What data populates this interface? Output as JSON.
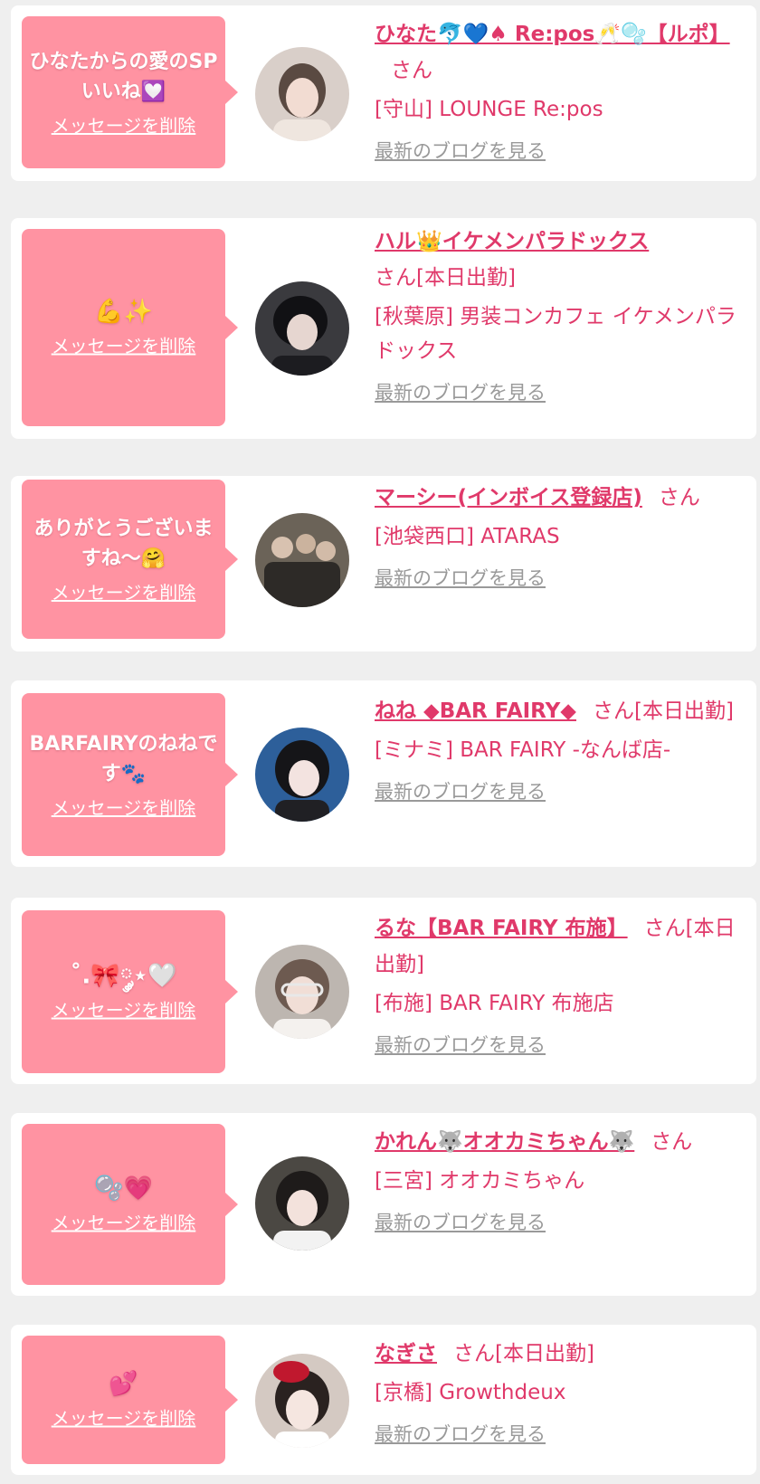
{
  "colors": {
    "background": "#efefef",
    "card": "#ffffff",
    "bubble": "#ff93a2",
    "accent": "#e0396a",
    "muted_link": "#999999"
  },
  "common": {
    "delete_label": "メッセージを削除",
    "blog_label": "最新のブログを見る",
    "san_label": "さん"
  },
  "items": [
    {
      "message": "ひなたからの愛のSPいいね💟",
      "name": "ひなた🐬💙♠ Re:pos🥂🫧【ルポ】",
      "status": "",
      "shop": "[守山] LOUNGE Re:pos",
      "avatar_icon": "avatar-photo-hinata"
    },
    {
      "message": "💪✨",
      "name": "ハル👑イケメンパラドックス",
      "status": "[本日出勤]",
      "shop": "[秋葉原] 男装コンカフェ イケメンパラドックス",
      "avatar_icon": "avatar-photo-haru"
    },
    {
      "message": "ありがとうございますね〜🤗",
      "name": "マーシー(インボイス登録店)",
      "status": "",
      "shop": "[池袋西口] ATARAS",
      "avatar_icon": "avatar-photo-marcy"
    },
    {
      "message": "BARFAIRYのねねです🐾",
      "name": "ねね ◆BAR FAIRY◆",
      "status": "[本日出勤]",
      "shop": "[ミナミ] BAR FAIRY -なんば店-",
      "avatar_icon": "avatar-photo-nene"
    },
    {
      "message": "˚.🎀༘⋆🤍",
      "name": "るな【BAR FAIRY 布施】",
      "status": "[本日出勤]",
      "shop": "[布施] BAR FAIRY 布施店",
      "avatar_icon": "avatar-photo-runa"
    },
    {
      "message": "🫧💗",
      "name": "かれん🐺オオカミちゃん🐺",
      "status": "",
      "shop": "[三宮] オオカミちゃん",
      "avatar_icon": "avatar-photo-karen"
    },
    {
      "message": "💕",
      "name": "なぎさ",
      "status": "[本日出勤]",
      "shop": "[京橋] Growthdeux",
      "avatar_icon": "avatar-photo-nagisa"
    }
  ]
}
